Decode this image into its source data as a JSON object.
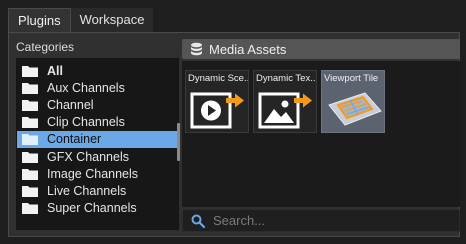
{
  "tabs": [
    {
      "label": "Plugins",
      "active": true
    },
    {
      "label": "Workspace",
      "active": false
    }
  ],
  "categories": {
    "title": "Categories",
    "items": [
      {
        "label": "All",
        "bold": true,
        "selected": false
      },
      {
        "label": "Aux Channels",
        "bold": false,
        "selected": false
      },
      {
        "label": "Channel",
        "bold": false,
        "selected": false
      },
      {
        "label": "Clip Channels",
        "bold": false,
        "selected": false
      },
      {
        "label": "Container",
        "bold": false,
        "selected": true
      },
      {
        "label": "GFX Channels",
        "bold": false,
        "selected": false
      },
      {
        "label": "Image Channels",
        "bold": false,
        "selected": false
      },
      {
        "label": "Live Channels",
        "bold": false,
        "selected": false
      },
      {
        "label": "Super Channels",
        "bold": false,
        "selected": false
      }
    ]
  },
  "assets": {
    "title": "Media Assets",
    "icon": "database-icon",
    "tiles": [
      {
        "label": "Dynamic Sce...",
        "icon": "play-arrow-icon"
      },
      {
        "label": "Dynamic Tex...",
        "icon": "image-arrow-icon"
      },
      {
        "label": "Viewport Tile",
        "icon": "viewport-tile-icon"
      }
    ]
  },
  "search": {
    "placeholder": "Search...",
    "value": ""
  },
  "colors": {
    "selection": "#6aa8e8",
    "accent_arrow": "#f39a1e",
    "panel": "#303030",
    "header": "#555555"
  }
}
